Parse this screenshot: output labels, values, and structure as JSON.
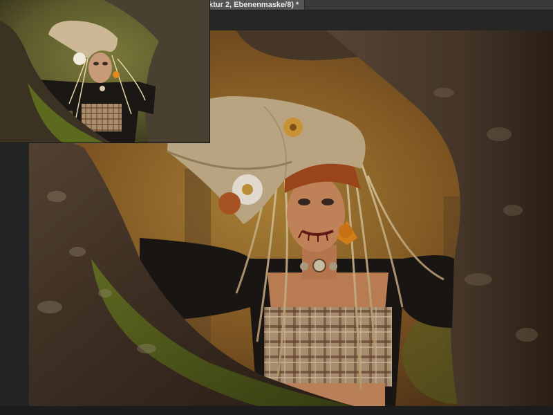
{
  "document": {
    "tab_title": "ektur 2, Ebenenmaske/8) *"
  },
  "canvas": {
    "image": "scarecrow-costume-portrait",
    "description_icon": "photo-canvas"
  },
  "thumbnail": {
    "image": "scarecrow-before-preview"
  },
  "colors": {
    "ui_dark": "#232323",
    "tab_active": "#555555",
    "tab_text": "#e6e6e6",
    "trunk": "#4a3a2c",
    "moss": "#5c6a1e",
    "background_warm": "#9a6a2a",
    "hat_burlap": "#c9b28c",
    "sweater": "#1b1714",
    "plaid": "#b59a7a"
  }
}
